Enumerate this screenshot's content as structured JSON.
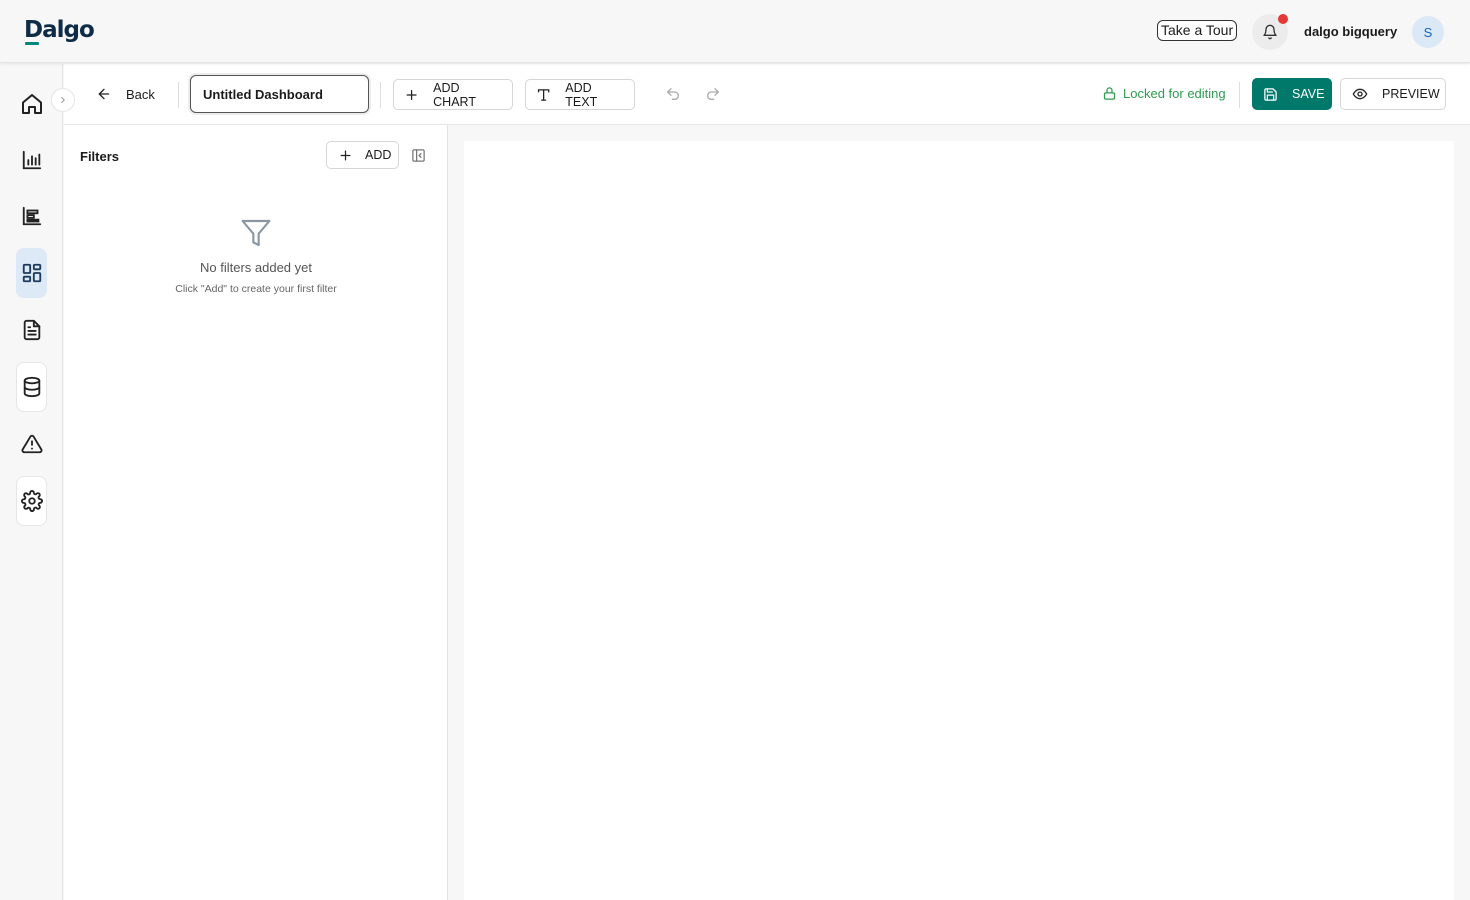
{
  "header": {
    "logo": "Dalgo",
    "tour_label": "Take a Tour",
    "user_name": "dalgo bigquery",
    "avatar_initial": "S",
    "notification_indicator": true
  },
  "nav": {
    "items": [
      {
        "name": "home",
        "icon": "home-icon"
      },
      {
        "name": "charts",
        "icon": "bar-chart-icon"
      },
      {
        "name": "reports",
        "icon": "horizontal-bars-icon"
      },
      {
        "name": "dashboards",
        "icon": "dashboard-grid-icon",
        "active": true
      },
      {
        "name": "documents",
        "icon": "document-icon"
      },
      {
        "name": "data",
        "icon": "database-icon"
      },
      {
        "name": "alerts",
        "icon": "warning-icon"
      },
      {
        "name": "settings",
        "icon": "gear-icon"
      }
    ]
  },
  "toolbar": {
    "back_label": "Back",
    "dashboard_title": "Untitled Dashboard",
    "add_chart_label": "ADD CHART",
    "add_text_label": "ADD TEXT",
    "lock_status": "Locked for editing",
    "save_label": "SAVE",
    "preview_label": "PREVIEW"
  },
  "filters": {
    "title": "Filters",
    "add_label": "ADD",
    "empty_title": "No filters added yet",
    "empty_hint": "Click \"Add\" to create your first filter"
  },
  "colors": {
    "accent": "#00796b",
    "lock_green": "#2e9c4f",
    "notification": "#e53935",
    "active_nav_bg": "#dde9f7"
  }
}
